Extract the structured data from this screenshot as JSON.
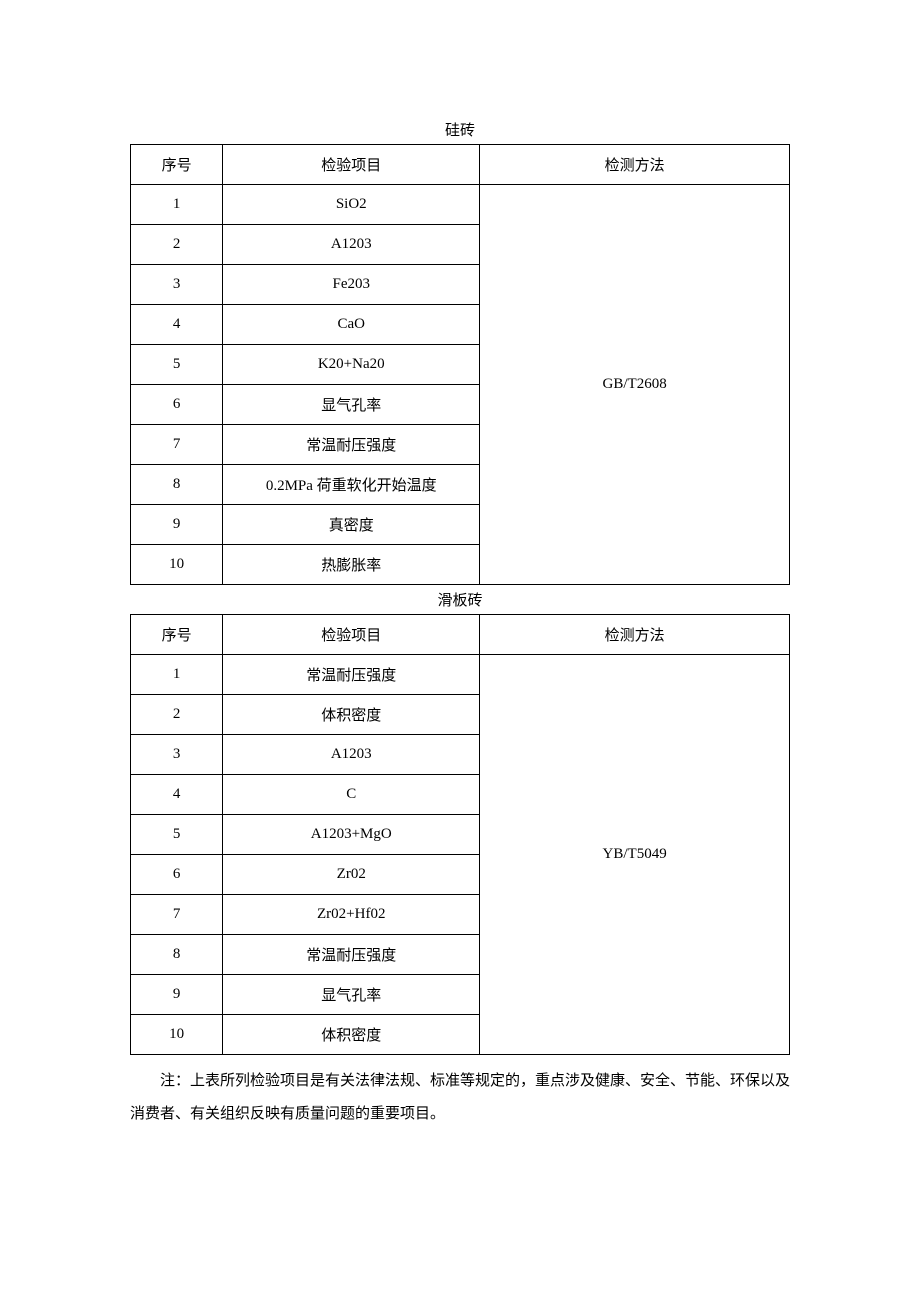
{
  "tables": [
    {
      "title": "硅砖",
      "headers": [
        "序号",
        "检验项目",
        "检测方法"
      ],
      "method": "GB/T2608",
      "rows": [
        {
          "no": "1",
          "item": "SiO2"
        },
        {
          "no": "2",
          "item": "A1203"
        },
        {
          "no": "3",
          "item": "Fe203"
        },
        {
          "no": "4",
          "item": "CaO"
        },
        {
          "no": "5",
          "item": "K20+Na20"
        },
        {
          "no": "6",
          "item": "显气孔率"
        },
        {
          "no": "7",
          "item": "常温耐压强度"
        },
        {
          "no": "8",
          "item": "0.2MPa 荷重软化开始温度"
        },
        {
          "no": "9",
          "item": "真密度"
        },
        {
          "no": "10",
          "item": "热膨胀率"
        }
      ]
    },
    {
      "title": "滑板砖",
      "headers": [
        "序号",
        "检验项目",
        "检测方法"
      ],
      "method": "YB/T5049",
      "rows": [
        {
          "no": "1",
          "item": "常温耐压强度"
        },
        {
          "no": "2",
          "item": "体积密度"
        },
        {
          "no": "3",
          "item": "A1203"
        },
        {
          "no": "4",
          "item": "C"
        },
        {
          "no": "5",
          "item": "A1203+MgO"
        },
        {
          "no": "6",
          "item": "Zr02"
        },
        {
          "no": "7",
          "item": "Zr02+Hf02"
        },
        {
          "no": "8",
          "item": "常温耐压强度"
        },
        {
          "no": "9",
          "item": "显气孔率"
        },
        {
          "no": "10",
          "item": "体积密度"
        }
      ]
    }
  ],
  "note": "注：上表所列检验项目是有关法律法规、标准等规定的，重点涉及健康、安全、节能、环保以及消费者、有关组织反映有质量问题的重要项目。"
}
